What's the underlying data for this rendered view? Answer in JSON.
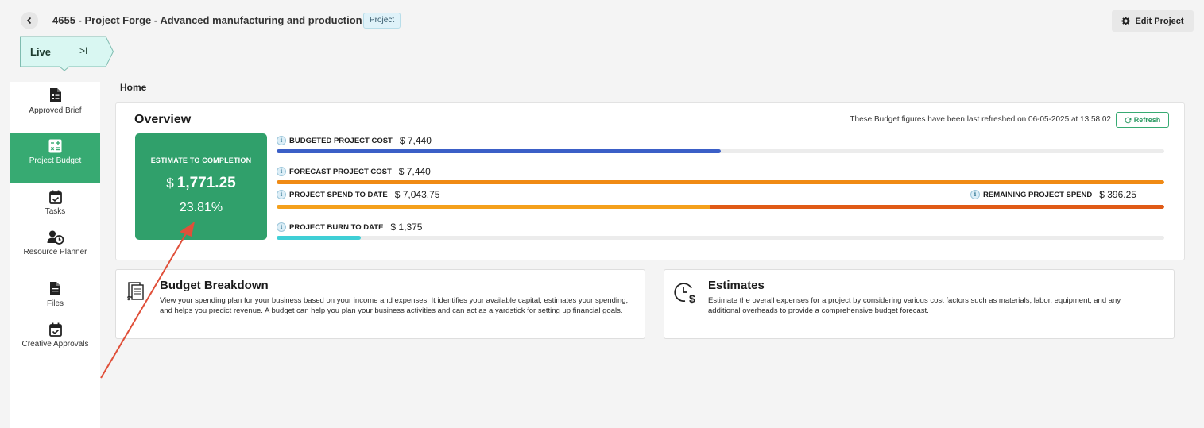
{
  "header": {
    "title": "4655 - Project Forge - Advanced manufacturing and production",
    "tag": "Project",
    "edit_label": "Edit Project"
  },
  "status": {
    "label": "Live",
    "arrow": ">I",
    "color": "#d9f7f2"
  },
  "sidebar": {
    "items": [
      {
        "label": "Approved Brief",
        "icon": "brief-icon",
        "active": false
      },
      {
        "label": "Project Budget",
        "icon": "calculator-icon",
        "active": true
      },
      {
        "label": "Tasks",
        "icon": "calendar-check-icon",
        "active": false
      },
      {
        "label": "Resource Planner",
        "icon": "user-clock-icon",
        "active": false
      },
      {
        "label": "Files",
        "icon": "file-icon",
        "active": false
      },
      {
        "label": "Creative Approvals",
        "icon": "calendar-check-icon",
        "active": false
      }
    ]
  },
  "breadcrumb": "Home",
  "overview": {
    "title": "Overview",
    "refresh_note": "These Budget figures have been last refreshed on 06-05-2025 at 13:58:02",
    "refresh_label": "Refresh",
    "estimate": {
      "label": "ESTIMATE TO COMPLETION",
      "currency": "$",
      "amount": "1,771.25",
      "percent": "23.81%"
    },
    "metrics": {
      "budgeted": {
        "label": "BUDGETED PROJECT COST",
        "value": "$ 7,440",
        "fill": 0.5,
        "color": "#3b5fc7"
      },
      "forecast": {
        "label": "FORECAST PROJECT COST",
        "value": "$ 7,440",
        "fill": 1.0,
        "color": "#f08a14"
      },
      "spend": {
        "label": "PROJECT SPEND TO DATE",
        "value": "$ 7,043.75",
        "fill": 0.488,
        "color": "#f4a01c"
      },
      "remaining": {
        "label": "REMAINING PROJECT SPEND",
        "value": "$ 396.25",
        "color": "#e05a16"
      },
      "burn": {
        "label": "PROJECT BURN TO DATE",
        "value": "$ 1,375",
        "fill": 0.095,
        "color": "#3fcfd6"
      }
    }
  },
  "cards": {
    "budget_breakdown": {
      "title": "Budget Breakdown",
      "description": "View your spending plan for your business based on your income and expenses. It identifies your available capital, estimates your spending, and helps you predict revenue. A budget can help you plan your business activities and can act as a yardstick for setting up financial goals."
    },
    "estimates": {
      "title": "Estimates",
      "description": "Estimate the overall expenses for a project by considering various cost factors such as materials, labor, equipment, and any additional overheads to provide a comprehensive budget forecast."
    }
  }
}
